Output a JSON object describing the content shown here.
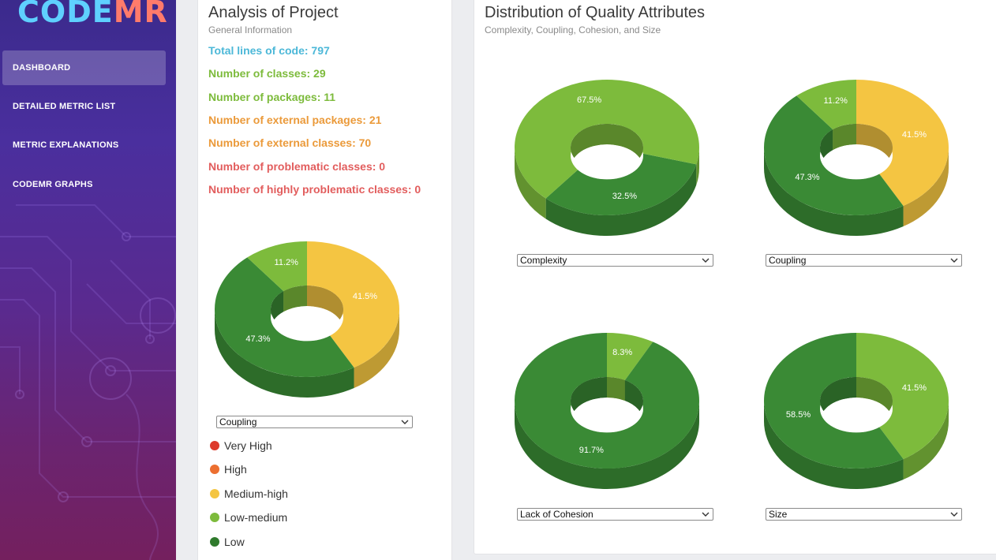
{
  "app": {
    "logo_prefix": "CODE",
    "logo_suffix": "MR"
  },
  "sidebar": {
    "items": [
      {
        "label": "DASHBOARD",
        "active": true
      },
      {
        "label": "DETAILED METRIC LIST",
        "active": false
      },
      {
        "label": "METRIC EXPLANATIONS",
        "active": false
      },
      {
        "label": "CODEMR GRAPHS",
        "active": false
      }
    ]
  },
  "analysis": {
    "title": "Analysis of Project",
    "subtitle": "General Information",
    "stats": [
      {
        "text": "Total lines of code: 797",
        "color": "#4cb8d8"
      },
      {
        "text": "Number of classes: 29",
        "color": "#7dbb3c"
      },
      {
        "text": "Number of packages: 11",
        "color": "#7dbb3c"
      },
      {
        "text": "Number of external packages: 21",
        "color": "#eb9a3a"
      },
      {
        "text": "Number of external classes: 70",
        "color": "#eb9a3a"
      },
      {
        "text": "Number of problematic classes: 0",
        "color": "#e25d5d"
      },
      {
        "text": "Number of highly problematic classes: 0",
        "color": "#e25d5d"
      }
    ],
    "select_value": "Coupling",
    "legend": [
      {
        "label": "Very High",
        "color": "#dd3a2c"
      },
      {
        "label": "High",
        "color": "#ec6f30"
      },
      {
        "label": "Medium-high",
        "color": "#f4c542"
      },
      {
        "label": "Low-medium",
        "color": "#7dbb3c"
      },
      {
        "label": "Low",
        "color": "#2f7a2c"
      }
    ]
  },
  "distribution": {
    "title": "Distribution of Quality Attributes",
    "subtitle": "Complexity, Coupling, Cohesion, and Size",
    "selects": [
      "Complexity",
      "Coupling",
      "Lack of Cohesion",
      "Size"
    ]
  },
  "colors": {
    "low": "#3a8a35",
    "low_side": "#2a6a26",
    "low_medium": "#7dbb3c",
    "low_medium_side": "#5e9a2c",
    "medium_high": "#f4c542",
    "medium_high_side": "#c9a233"
  },
  "chart_data": [
    {
      "type": "pie",
      "id": "left-coupling",
      "slices": [
        {
          "label": "Medium-high",
          "value": 41.5,
          "text": "41.5%",
          "color": "#f4c542"
        },
        {
          "label": "Low",
          "value": 47.3,
          "text": "47.3%",
          "color": "#3a8a35"
        },
        {
          "label": "Low-medium",
          "value": 11.2,
          "text": "11.2%",
          "color": "#7dbb3c"
        }
      ]
    },
    {
      "type": "pie",
      "id": "complexity",
      "slices": [
        {
          "label": "Low",
          "value": 32.5,
          "text": "32.5%",
          "color": "#3a8a35"
        },
        {
          "label": "Low-medium",
          "value": 67.5,
          "text": "67.5%",
          "color": "#7dbb3c"
        }
      ]
    },
    {
      "type": "pie",
      "id": "coupling",
      "slices": [
        {
          "label": "Medium-high",
          "value": 41.5,
          "text": "41.5%",
          "color": "#f4c542"
        },
        {
          "label": "Low",
          "value": 47.3,
          "text": "47.3%",
          "color": "#3a8a35"
        },
        {
          "label": "Low-medium",
          "value": 11.2,
          "text": "11.2%",
          "color": "#7dbb3c"
        }
      ]
    },
    {
      "type": "pie",
      "id": "cohesion",
      "slices": [
        {
          "label": "Low-medium",
          "value": 8.3,
          "text": "8.3%",
          "color": "#7dbb3c"
        },
        {
          "label": "Low",
          "value": 91.7,
          "text": "91.7%",
          "color": "#3a8a35"
        }
      ]
    },
    {
      "type": "pie",
      "id": "size",
      "slices": [
        {
          "label": "Low-medium",
          "value": 41.5,
          "text": "41.5%",
          "color": "#7dbb3c"
        },
        {
          "label": "Low",
          "value": 58.5,
          "text": "58.5%",
          "color": "#3a8a35"
        }
      ]
    }
  ]
}
